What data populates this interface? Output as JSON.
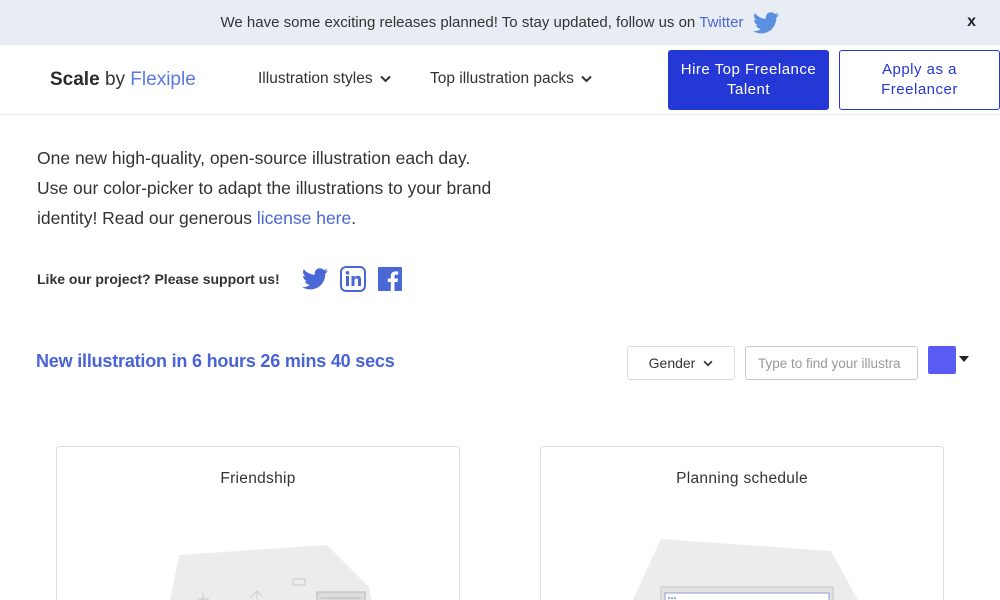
{
  "announcement": {
    "text": "We have some exciting releases planned! To stay updated, follow us on",
    "link": "Twitter",
    "close": "x"
  },
  "header": {
    "brand": {
      "part1": "Scale",
      "part2": "by",
      "part3": "Flexiple"
    },
    "nav": [
      {
        "label": "Illustration styles",
        "icon": "chevron-down-icon"
      },
      {
        "label": "Top illustration packs",
        "icon": "chevron-down-icon"
      }
    ],
    "hire_button": "Hire Top Freelance Talent",
    "apply_button": "Apply as a Freelancer"
  },
  "intro": {
    "text": "One new high-quality, open-source illustration each day. Use our color-picker to adapt the illustrations to your brand identity! Read our generous",
    "license_link": "license here",
    "period": "."
  },
  "support": {
    "label": "Like our project? Please support us!",
    "icons": [
      "twitter-icon",
      "linkedin-icon",
      "facebook-icon"
    ]
  },
  "toolbar": {
    "countdown": "New illustration in  6 hours 26 mins 40 secs",
    "gender_label": "Gender",
    "search_placeholder": "Type to find your illustra",
    "color": "#5a5bf5"
  },
  "cards": [
    {
      "title": "Friendship"
    },
    {
      "title": "Planning schedule"
    }
  ],
  "colors": {
    "accent": "#4a67d6",
    "primary_button": "#2538d6",
    "announcement_bg": "#e8edf5"
  }
}
